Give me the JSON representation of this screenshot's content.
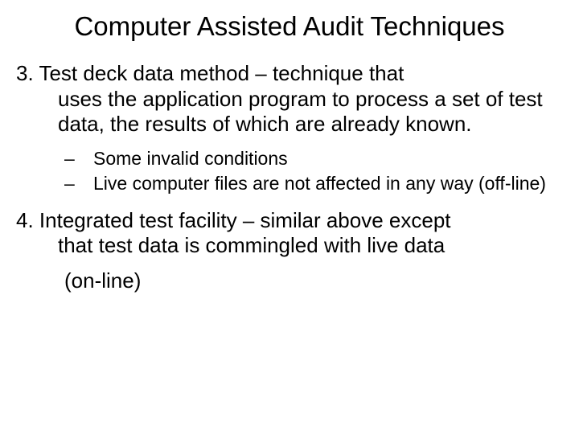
{
  "title": "Computer Assisted Audit Techniques",
  "item3": {
    "number": "3.",
    "firstline": "Test deck data method  – technique that",
    "rest": "uses the application program to process a set of test data, the results of which are already known.",
    "sub1": "Some invalid conditions",
    "sub2": "Live computer files are not affected in any way (off-line)"
  },
  "item4": {
    "number": "4.",
    "firstline": "Integrated test facility – similar above except",
    "rest": "that test data is commingled with live data",
    "tail": " (on-line)"
  },
  "dash": "–"
}
